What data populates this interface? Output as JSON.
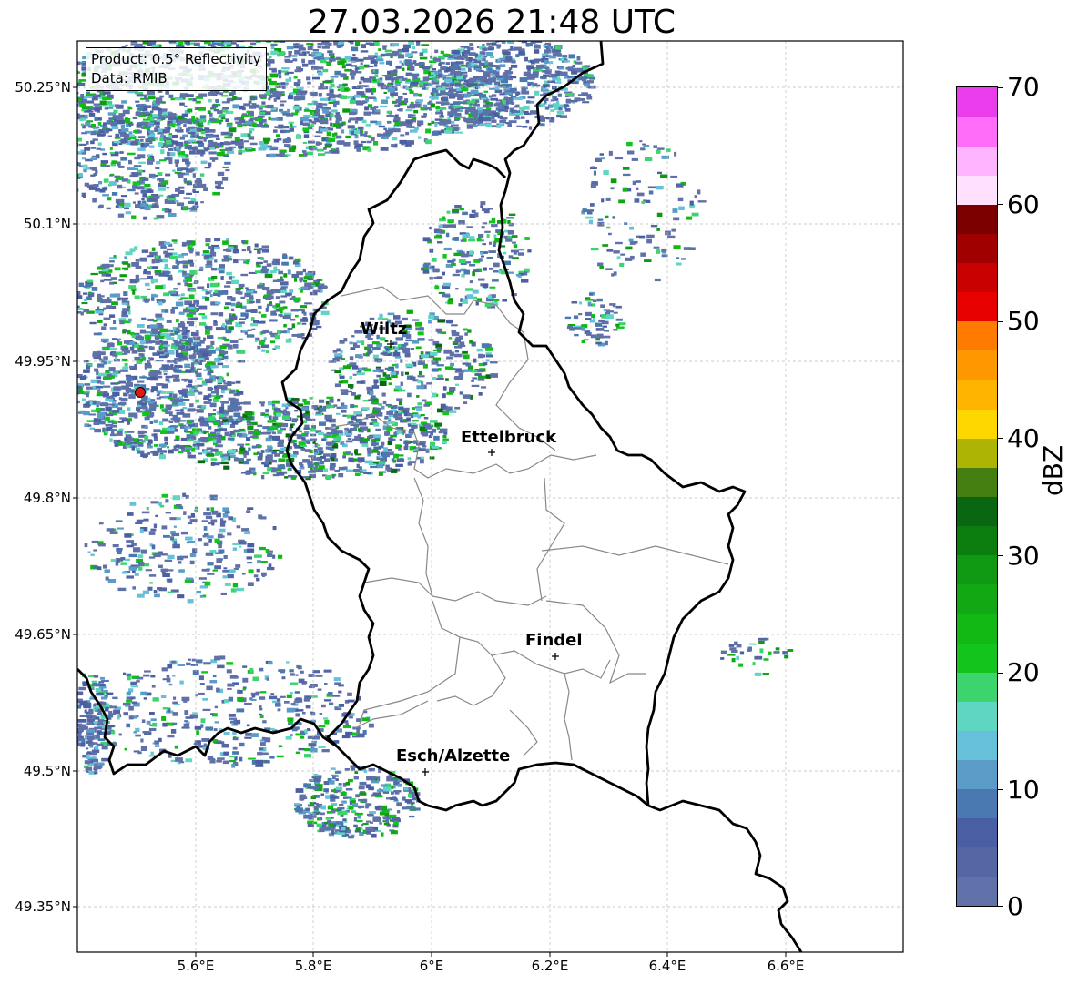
{
  "title": "27.03.2026 21:48 UTC",
  "info_box": {
    "product": "Product: 0.5° Reflectivity",
    "source": "Data: RMIB"
  },
  "lat_labels": [
    "50.25°N",
    "50.1°N",
    "49.95°N",
    "49.8°N",
    "49.65°N",
    "49.5°N",
    "49.35°N"
  ],
  "lon_labels": [
    "5.6°E",
    "5.8°E",
    "6°E",
    "6.2°E",
    "6.4°E",
    "6.6°E"
  ],
  "cities": [
    {
      "name": "Wiltz"
    },
    {
      "name": "Ettelbruck"
    },
    {
      "name": "Findel"
    },
    {
      "name": "Esch/Alzette"
    }
  ],
  "colorbar": {
    "unit": "dBZ",
    "ticks": [
      "70",
      "60",
      "50",
      "40",
      "30",
      "20",
      "10",
      "0"
    ],
    "colors": [
      "#6070a8",
      "#5467a4",
      "#4a5ea3",
      "#4a78b0",
      "#5a9cc7",
      "#66c0da",
      "#5fd6c2",
      "#3cd46c",
      "#12c41c",
      "#12b814",
      "#12a814",
      "#0f9812",
      "#0b7c0e",
      "#0a6610",
      "#447d10",
      "#aeb404",
      "#ffd700",
      "#ffb400",
      "#ff9800",
      "#ff7a00",
      "#e60000",
      "#c80000",
      "#a00000",
      "#7c0000",
      "#ffe0ff",
      "#ffb4ff",
      "#ff6cf8",
      "#ea3cea"
    ]
  },
  "colors": {
    "radar_site": "#e8160c",
    "border": "#000000",
    "cantons": "#888888"
  }
}
